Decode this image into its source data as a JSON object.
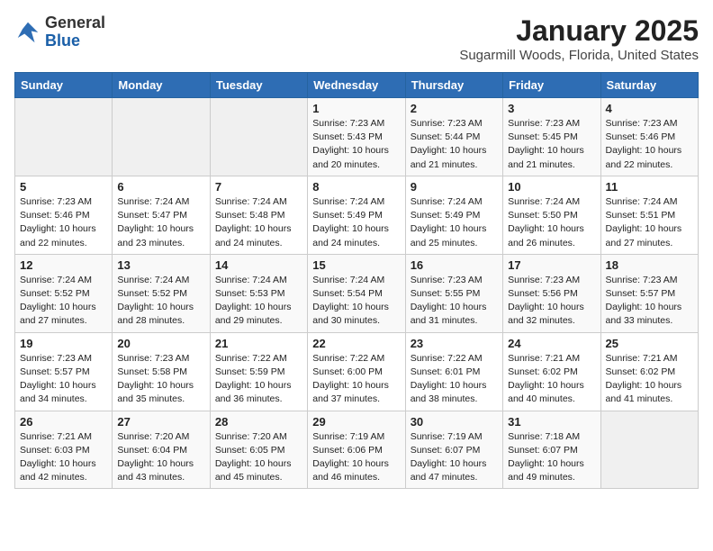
{
  "header": {
    "logo_general": "General",
    "logo_blue": "Blue",
    "month_title": "January 2025",
    "location": "Sugarmill Woods, Florida, United States"
  },
  "days_of_week": [
    "Sunday",
    "Monday",
    "Tuesday",
    "Wednesday",
    "Thursday",
    "Friday",
    "Saturday"
  ],
  "weeks": [
    [
      {
        "num": "",
        "info": ""
      },
      {
        "num": "",
        "info": ""
      },
      {
        "num": "",
        "info": ""
      },
      {
        "num": "1",
        "info": "Sunrise: 7:23 AM\nSunset: 5:43 PM\nDaylight: 10 hours\nand 20 minutes."
      },
      {
        "num": "2",
        "info": "Sunrise: 7:23 AM\nSunset: 5:44 PM\nDaylight: 10 hours\nand 21 minutes."
      },
      {
        "num": "3",
        "info": "Sunrise: 7:23 AM\nSunset: 5:45 PM\nDaylight: 10 hours\nand 21 minutes."
      },
      {
        "num": "4",
        "info": "Sunrise: 7:23 AM\nSunset: 5:46 PM\nDaylight: 10 hours\nand 22 minutes."
      }
    ],
    [
      {
        "num": "5",
        "info": "Sunrise: 7:23 AM\nSunset: 5:46 PM\nDaylight: 10 hours\nand 22 minutes."
      },
      {
        "num": "6",
        "info": "Sunrise: 7:24 AM\nSunset: 5:47 PM\nDaylight: 10 hours\nand 23 minutes."
      },
      {
        "num": "7",
        "info": "Sunrise: 7:24 AM\nSunset: 5:48 PM\nDaylight: 10 hours\nand 24 minutes."
      },
      {
        "num": "8",
        "info": "Sunrise: 7:24 AM\nSunset: 5:49 PM\nDaylight: 10 hours\nand 24 minutes."
      },
      {
        "num": "9",
        "info": "Sunrise: 7:24 AM\nSunset: 5:49 PM\nDaylight: 10 hours\nand 25 minutes."
      },
      {
        "num": "10",
        "info": "Sunrise: 7:24 AM\nSunset: 5:50 PM\nDaylight: 10 hours\nand 26 minutes."
      },
      {
        "num": "11",
        "info": "Sunrise: 7:24 AM\nSunset: 5:51 PM\nDaylight: 10 hours\nand 27 minutes."
      }
    ],
    [
      {
        "num": "12",
        "info": "Sunrise: 7:24 AM\nSunset: 5:52 PM\nDaylight: 10 hours\nand 27 minutes."
      },
      {
        "num": "13",
        "info": "Sunrise: 7:24 AM\nSunset: 5:52 PM\nDaylight: 10 hours\nand 28 minutes."
      },
      {
        "num": "14",
        "info": "Sunrise: 7:24 AM\nSunset: 5:53 PM\nDaylight: 10 hours\nand 29 minutes."
      },
      {
        "num": "15",
        "info": "Sunrise: 7:24 AM\nSunset: 5:54 PM\nDaylight: 10 hours\nand 30 minutes."
      },
      {
        "num": "16",
        "info": "Sunrise: 7:23 AM\nSunset: 5:55 PM\nDaylight: 10 hours\nand 31 minutes."
      },
      {
        "num": "17",
        "info": "Sunrise: 7:23 AM\nSunset: 5:56 PM\nDaylight: 10 hours\nand 32 minutes."
      },
      {
        "num": "18",
        "info": "Sunrise: 7:23 AM\nSunset: 5:57 PM\nDaylight: 10 hours\nand 33 minutes."
      }
    ],
    [
      {
        "num": "19",
        "info": "Sunrise: 7:23 AM\nSunset: 5:57 PM\nDaylight: 10 hours\nand 34 minutes."
      },
      {
        "num": "20",
        "info": "Sunrise: 7:23 AM\nSunset: 5:58 PM\nDaylight: 10 hours\nand 35 minutes."
      },
      {
        "num": "21",
        "info": "Sunrise: 7:22 AM\nSunset: 5:59 PM\nDaylight: 10 hours\nand 36 minutes."
      },
      {
        "num": "22",
        "info": "Sunrise: 7:22 AM\nSunset: 6:00 PM\nDaylight: 10 hours\nand 37 minutes."
      },
      {
        "num": "23",
        "info": "Sunrise: 7:22 AM\nSunset: 6:01 PM\nDaylight: 10 hours\nand 38 minutes."
      },
      {
        "num": "24",
        "info": "Sunrise: 7:21 AM\nSunset: 6:02 PM\nDaylight: 10 hours\nand 40 minutes."
      },
      {
        "num": "25",
        "info": "Sunrise: 7:21 AM\nSunset: 6:02 PM\nDaylight: 10 hours\nand 41 minutes."
      }
    ],
    [
      {
        "num": "26",
        "info": "Sunrise: 7:21 AM\nSunset: 6:03 PM\nDaylight: 10 hours\nand 42 minutes."
      },
      {
        "num": "27",
        "info": "Sunrise: 7:20 AM\nSunset: 6:04 PM\nDaylight: 10 hours\nand 43 minutes."
      },
      {
        "num": "28",
        "info": "Sunrise: 7:20 AM\nSunset: 6:05 PM\nDaylight: 10 hours\nand 45 minutes."
      },
      {
        "num": "29",
        "info": "Sunrise: 7:19 AM\nSunset: 6:06 PM\nDaylight: 10 hours\nand 46 minutes."
      },
      {
        "num": "30",
        "info": "Sunrise: 7:19 AM\nSunset: 6:07 PM\nDaylight: 10 hours\nand 47 minutes."
      },
      {
        "num": "31",
        "info": "Sunrise: 7:18 AM\nSunset: 6:07 PM\nDaylight: 10 hours\nand 49 minutes."
      },
      {
        "num": "",
        "info": ""
      }
    ]
  ]
}
